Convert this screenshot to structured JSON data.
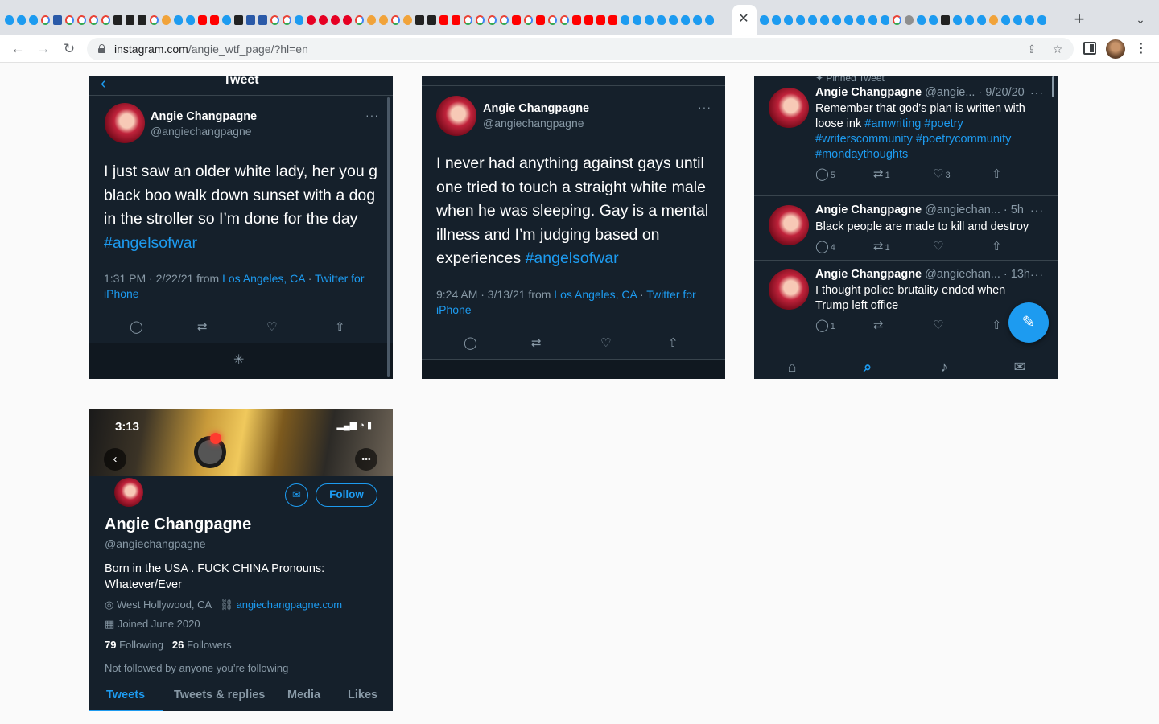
{
  "browser": {
    "url_host": "instagram.com",
    "url_path": "/angie_wtf_page/?hl=en",
    "active_tab_close": "✕",
    "new_tab": "+"
  },
  "profile": {
    "name": "Angie Changpagne",
    "handle": "@angiechangpagne"
  },
  "card1": {
    "header_title": "Tweet",
    "text": "I just saw an older white lady, her you g black boo walk down sunset with a dog in the stroller so I’m done for the day",
    "hashtag": "#angelsofwar",
    "meta_time": "1:31 PM · 2/22/21 from",
    "meta_place": "Los Angeles, CA",
    "meta_sep": "·",
    "meta_client": "Twitter for iPhone"
  },
  "card2": {
    "text": "I never had anything against gays until one tried to touch a straight white male when he was sleeping. Gay is a mental illness and I’m judging based on experiences",
    "hashtag": "#angelsofwar",
    "meta_time": "9:24 AM · 3/13/21 from",
    "meta_place": "Los Angeles, CA",
    "meta_sep": "·",
    "meta_client": "Twitter for iPhone"
  },
  "card3": {
    "pinned_label": "Pinned Tweet",
    "tweets": [
      {
        "handle": "@angie...",
        "time": "· 9/20/20",
        "text": "Remember that god’s plan is written with loose ink",
        "hashtags": "#amwriting #poetry #writerscommunity #poetrycommunity #mondaythoughts",
        "replies": "5",
        "retweets": "1",
        "likes": "3"
      },
      {
        "handle": "@angiechan...",
        "time": "· 5h",
        "text": "Black people are made to kill and destroy",
        "replies": "4",
        "retweets": "1",
        "likes": ""
      },
      {
        "handle": "@angiechan...",
        "time": "· 13h",
        "text": "I thought police brutality ended when Trump left office",
        "replies": "1",
        "retweets": "",
        "likes": ""
      }
    ]
  },
  "card4": {
    "status_time": "3:13",
    "follow_label": "Follow",
    "bio": "Born in the USA . FUCK CHINA Pronouns: Whatever/Ever",
    "location": "West Hollywood, CA",
    "website": "angiechangpagne.com",
    "joined": "Joined June 2020",
    "following_count": "79",
    "following_label": "Following",
    "followers_count": "26",
    "followers_label": "Followers",
    "not_followed": "Not followed by anyone you’re following",
    "tabs": [
      "Tweets",
      "Tweets & replies",
      "Media",
      "Likes"
    ]
  }
}
